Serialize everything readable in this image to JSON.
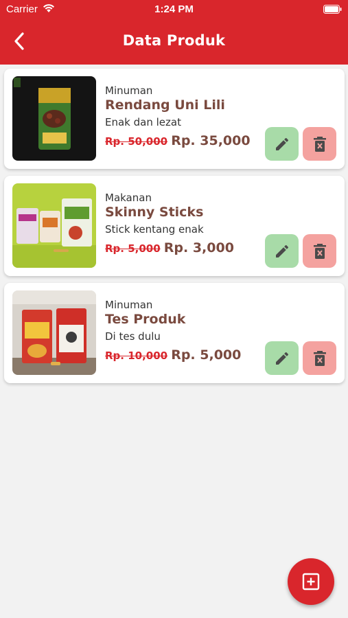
{
  "status_bar": {
    "carrier": "Carrier",
    "time": "1:24 PM"
  },
  "header": {
    "title": "Data Produk",
    "back_icon": "chevron-left-icon"
  },
  "colors": {
    "primary": "#d9262c",
    "name_text": "#7a4a3f",
    "edit_bg": "#a8dba8",
    "delete_bg": "#f4a29f"
  },
  "products": [
    {
      "category": "Minuman",
      "name": "Rendang Uni Lili",
      "description": "Enak dan lezat",
      "old_price": "Rp. 50,000",
      "price": "Rp. 35,000"
    },
    {
      "category": "Makanan",
      "name": "Skinny Sticks",
      "description": "Stick kentang enak",
      "old_price": "Rp. 5,000",
      "price": "Rp. 3,000"
    },
    {
      "category": "Minuman",
      "name": "Tes Produk",
      "description": "Di tes dulu",
      "old_price": "Rp. 10,000",
      "price": "Rp. 5,000"
    }
  ],
  "actions": {
    "edit_icon": "pencil-icon",
    "delete_icon": "trash-icon",
    "add_icon": "add-box-icon"
  }
}
